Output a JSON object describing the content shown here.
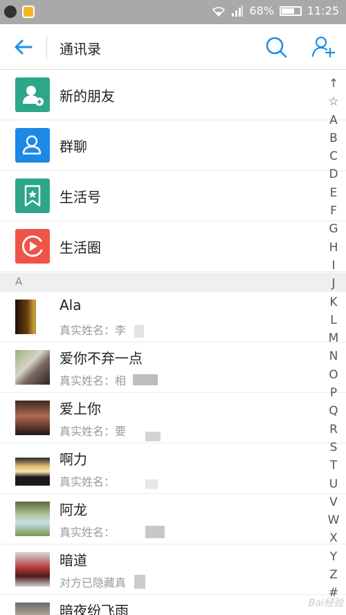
{
  "status_bar": {
    "battery_text": "68%",
    "battery_level": 0.68,
    "time": "11:25",
    "icons": [
      "qq-icon",
      "app-icon",
      "wifi-icon",
      "signal-icon",
      "battery-icon"
    ]
  },
  "header": {
    "title": "通讯录",
    "back_icon": "back-arrow-icon",
    "search_icon": "search-icon",
    "add_icon": "add-user-icon"
  },
  "functions": [
    {
      "label": "新的朋友",
      "icon": "new-friend-icon",
      "color": "#2ea68a"
    },
    {
      "label": "群聊",
      "icon": "group-chat-icon",
      "color": "#1e88e5"
    },
    {
      "label": "生活号",
      "icon": "life-account-icon",
      "color": "#2ea68a"
    },
    {
      "label": "生活圈",
      "icon": "life-circle-icon",
      "color": "#ee5448"
    }
  ],
  "section": "A",
  "contacts": [
    {
      "name": "Ala",
      "sub": "真实姓名：李"
    },
    {
      "name": "爱你不弃一点",
      "sub": "真实姓名：相"
    },
    {
      "name": "爱上你",
      "sub": "真实姓名：要"
    },
    {
      "name": "啊力",
      "sub": "真实姓名："
    },
    {
      "name": "阿龙",
      "sub": "真实姓名："
    },
    {
      "name": "暗道",
      "sub": "对方已隐藏真"
    },
    {
      "name": "暗夜纷飞雨",
      "sub": ""
    }
  ],
  "index_letters": [
    "↑",
    "☆",
    "A",
    "B",
    "C",
    "D",
    "E",
    "F",
    "G",
    "H",
    "I",
    "J",
    "K",
    "L",
    "M",
    "N",
    "O",
    "P",
    "Q",
    "R",
    "S",
    "T",
    "U",
    "V",
    "W",
    "X",
    "Y",
    "Z",
    "#"
  ],
  "watermark": "Bai经验"
}
